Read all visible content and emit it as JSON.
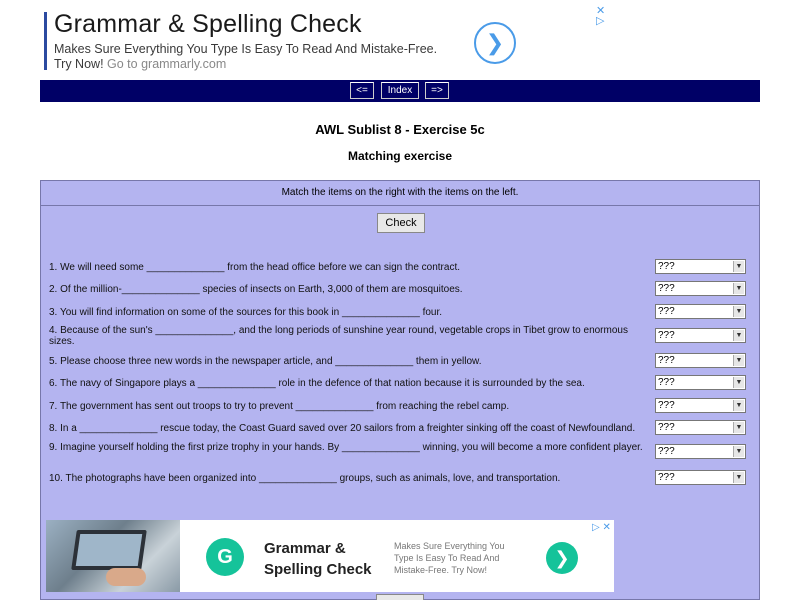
{
  "top_ad": {
    "title": "Grammar & Spelling Check",
    "description": "Makes Sure Everything You Type Is Easy To Read And Mistake-Free. Try Now!",
    "domain": "Go to grammarly.com",
    "next_glyph": "❯",
    "adchoices_glyph": "▷",
    "close_glyph": "✕"
  },
  "nav": {
    "prev": "<=",
    "index": "Index",
    "next": "=>"
  },
  "page": {
    "title": "AWL Sublist 8 - Exercise 5c",
    "subtitle": "Matching exercise"
  },
  "exercise": {
    "instruction": "Match the items on the right with the items on the left.",
    "check_label": "Check",
    "questions": [
      {
        "text": "1. We will need some ______________ from the head office before we can sign the contract.",
        "answer": "???"
      },
      {
        "text": "2. Of the million-______________ species of insects on Earth, 3,000 of them are mosquitoes.",
        "answer": "???"
      },
      {
        "text": "3. You will find information on some of the sources for this book in ______________ four.",
        "answer": "???"
      },
      {
        "text": "4. Because of the sun's ______________, and the long periods of sunshine year round, vegetable crops in Tibet grow to enormous sizes.",
        "answer": "???"
      },
      {
        "text": "5. Please choose three new words in the newspaper article, and ______________ them in yellow.",
        "answer": "???"
      },
      {
        "text": "6. The navy of Singapore plays a ______________ role in the defence of that nation because it is surrounded by the sea.",
        "answer": "???"
      },
      {
        "text": "7. The government has sent out troops to try to prevent ______________ from reaching the rebel camp.",
        "answer": "???"
      },
      {
        "text": "8. In a ______________ rescue today, the Coast Guard saved over 20 sailors from a freighter sinking off the coast of Newfoundland.",
        "answer": "???"
      },
      {
        "text": "9. Imagine yourself holding the first prize trophy in your hands. By ______________ winning, you will become a more confident player.",
        "answer": "???"
      },
      {
        "text": "10. The photographs have been organized into ______________ groups, such as animals, love, and transportation.",
        "answer": "???"
      }
    ]
  },
  "bottom_ad": {
    "logo_letter": "G",
    "title": "Grammar & Spelling Check",
    "description": "Makes Sure Everything You Type Is Easy To Read And Mistake-Free. Try Now!",
    "go_glyph": "❯",
    "choices": "▷ ✕"
  }
}
